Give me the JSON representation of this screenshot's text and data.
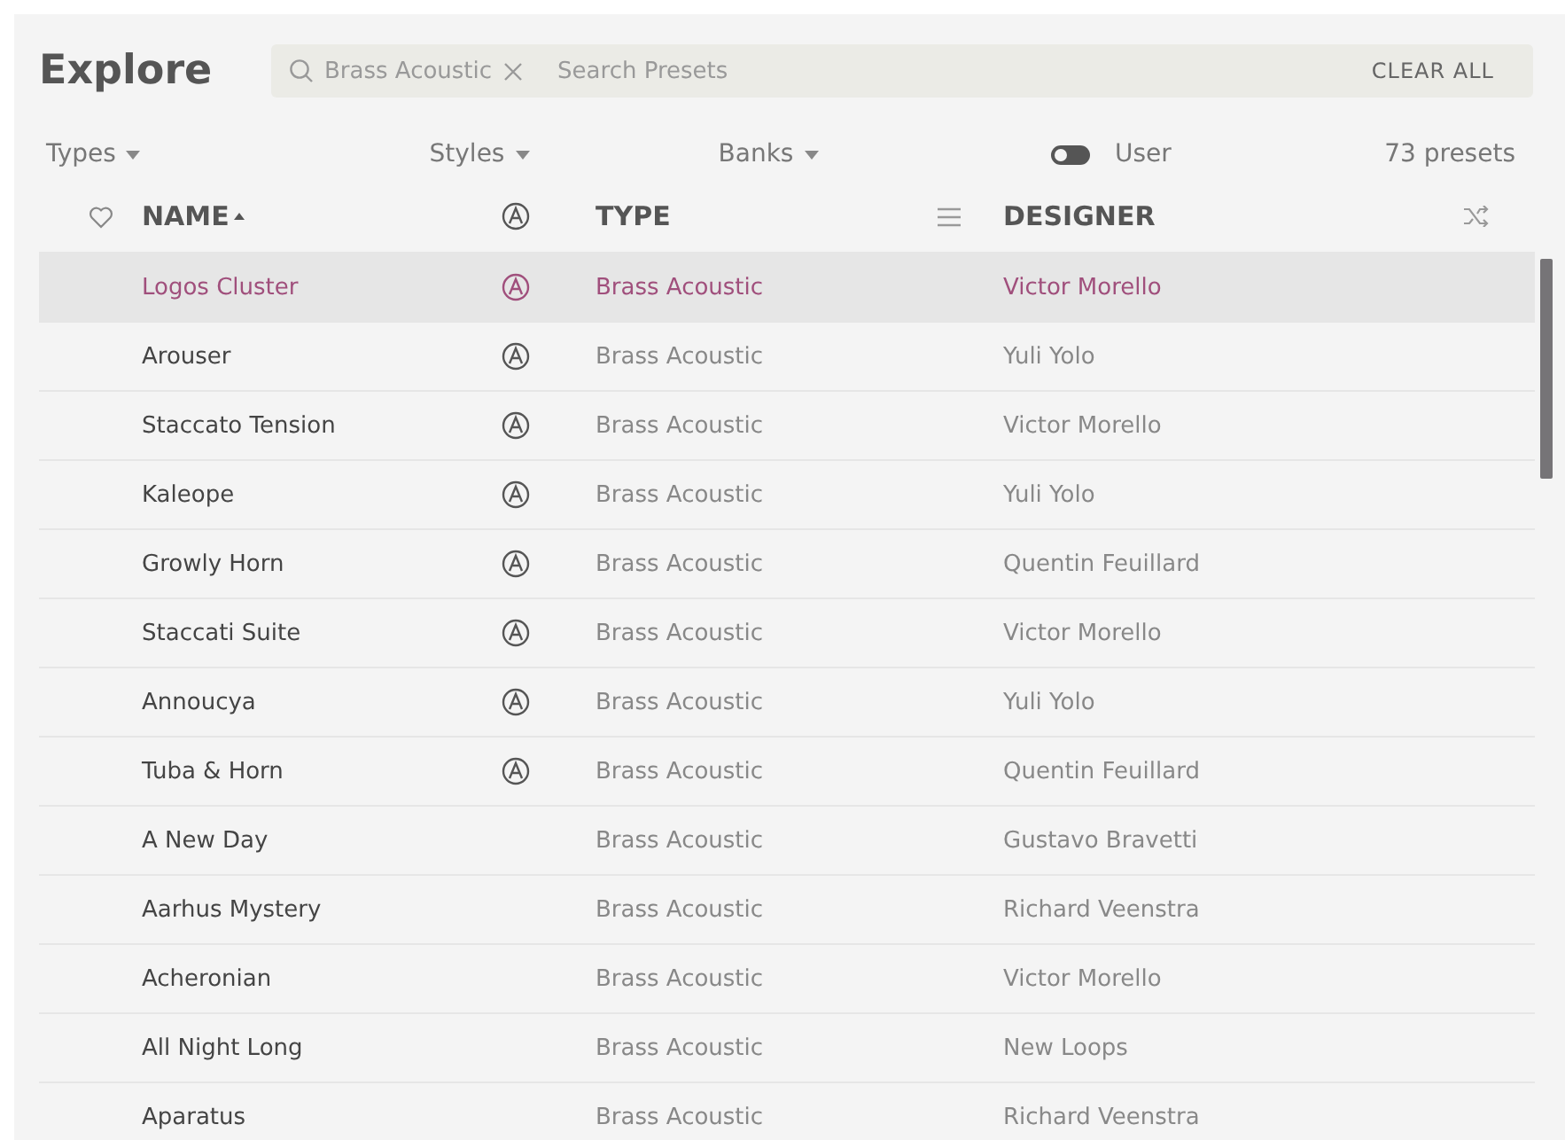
{
  "title": "Explore",
  "search": {
    "tag": "Brass Acoustic",
    "placeholder": "Search Presets",
    "clear": "CLEAR ALL"
  },
  "filters": [
    {
      "label": "Types"
    },
    {
      "label": "Styles"
    },
    {
      "label": "Banks"
    }
  ],
  "user_toggle": {
    "label": "User",
    "on": false
  },
  "count": "73 presets",
  "columns": {
    "name": "NAME",
    "type": "TYPE",
    "designer": "DESIGNER"
  },
  "rows": [
    {
      "name": "Logos Cluster",
      "factory": true,
      "type": "Brass Acoustic",
      "designer": "Victor Morello",
      "selected": true
    },
    {
      "name": "Arouser",
      "factory": true,
      "type": "Brass Acoustic",
      "designer": "Yuli Yolo",
      "selected": false
    },
    {
      "name": "Staccato Tension",
      "factory": true,
      "type": "Brass Acoustic",
      "designer": "Victor Morello",
      "selected": false
    },
    {
      "name": "Kaleope",
      "factory": true,
      "type": "Brass Acoustic",
      "designer": "Yuli Yolo",
      "selected": false
    },
    {
      "name": "Growly Horn",
      "factory": true,
      "type": "Brass Acoustic",
      "designer": "Quentin Feuillard",
      "selected": false
    },
    {
      "name": "Staccati Suite",
      "factory": true,
      "type": "Brass Acoustic",
      "designer": "Victor Morello",
      "selected": false
    },
    {
      "name": "Annoucya",
      "factory": true,
      "type": "Brass Acoustic",
      "designer": "Yuli Yolo",
      "selected": false
    },
    {
      "name": "Tuba & Horn",
      "factory": true,
      "type": "Brass Acoustic",
      "designer": "Quentin Feuillard",
      "selected": false
    },
    {
      "name": "A New Day",
      "factory": false,
      "type": "Brass Acoustic",
      "designer": "Gustavo Bravetti",
      "selected": false
    },
    {
      "name": "Aarhus Mystery",
      "factory": false,
      "type": "Brass Acoustic",
      "designer": "Richard Veenstra",
      "selected": false
    },
    {
      "name": "Acheronian",
      "factory": false,
      "type": "Brass Acoustic",
      "designer": "Victor Morello",
      "selected": false
    },
    {
      "name": "All Night Long",
      "factory": false,
      "type": "Brass Acoustic",
      "designer": "New Loops",
      "selected": false
    },
    {
      "name": "Aparatus",
      "factory": false,
      "type": "Brass Acoustic",
      "designer": "Richard Veenstra",
      "selected": false
    }
  ]
}
